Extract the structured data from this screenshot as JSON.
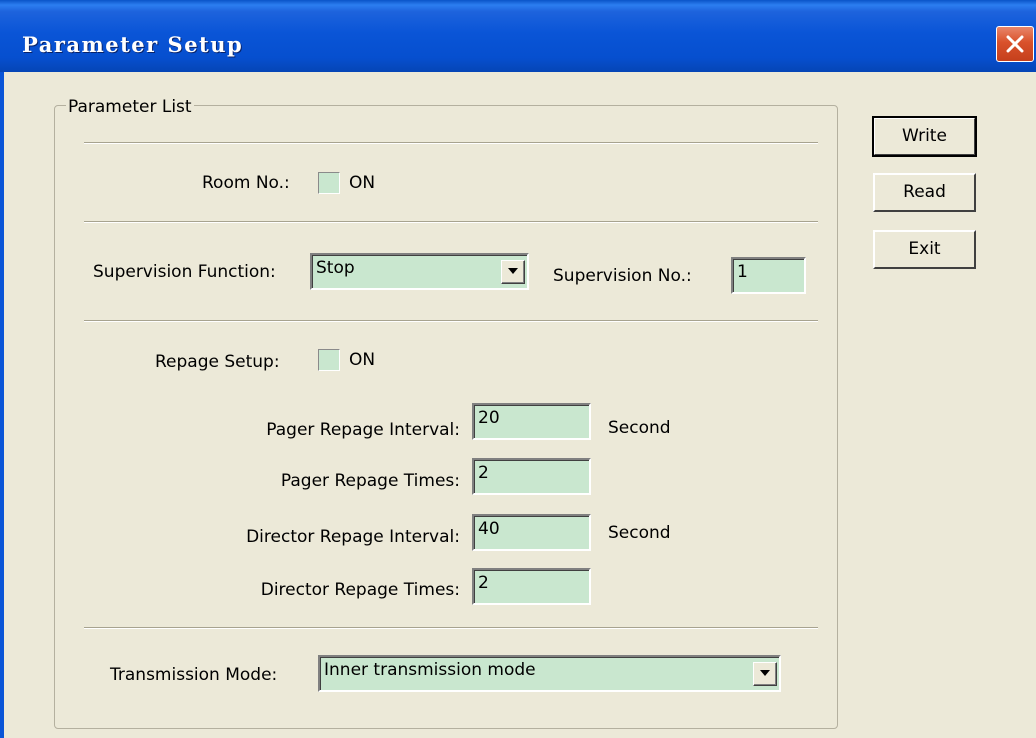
{
  "window": {
    "title": "Parameter Setup"
  },
  "group": {
    "title": "Parameter List"
  },
  "room": {
    "label": "Room No.:",
    "checkbox_label": "ON",
    "checked": false
  },
  "supervision": {
    "function_label": "Supervision Function:",
    "function_value": "Stop",
    "no_label": "Supervision No.:",
    "no_value": "1"
  },
  "repage": {
    "label": "Repage Setup:",
    "checkbox_label": "ON",
    "checked": false,
    "pager_interval_label": "Pager Repage Interval:",
    "pager_interval_value": "20",
    "pager_interval_unit": "Second",
    "pager_times_label": "Pager Repage Times:",
    "pager_times_value": "2",
    "director_interval_label": "Director Repage Interval:",
    "director_interval_value": "40",
    "director_interval_unit": "Second",
    "director_times_label": "Director Repage Times:",
    "director_times_value": "2"
  },
  "transmission": {
    "label": "Transmission Mode:",
    "value": "Inner transmission mode"
  },
  "buttons": {
    "write": "Write",
    "read": "Read",
    "exit": "Exit"
  },
  "icons": {
    "close": "close-icon",
    "dropdown": "chevron-down-icon"
  },
  "colors": {
    "titlebar": "#0A55D7",
    "field_bg": "#C9E7CF",
    "dialog_bg": "#ECE9D8",
    "close_button": "#D9512B"
  }
}
